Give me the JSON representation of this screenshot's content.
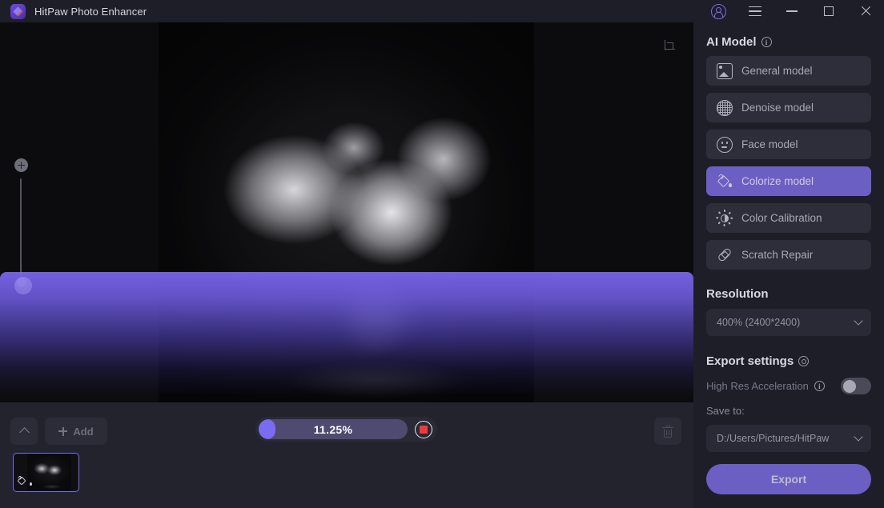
{
  "titlebar": {
    "app_title": "HitPaw Photo Enhancer",
    "logo_icon": "hitpaw-gem-icon",
    "account_icon": "user-account-icon",
    "menu_icon": "hamburger-menu-icon",
    "minimize_icon": "minimize-icon",
    "maximize_icon": "maximize-icon",
    "close_icon": "close-icon"
  },
  "canvas": {
    "crop_icon": "crop-icon",
    "zoom_in_icon": "zoom-in-plus-icon",
    "zoom_slider_handle": "zoom-slider-handle",
    "image_description": "Black and white photo of white roses in a vase"
  },
  "bottombar": {
    "collapse_icon": "chevron-up-icon",
    "add_label": "Add",
    "add_icon": "plus-icon",
    "delete_icon": "trash-icon",
    "thumbnail_badge_icon": "colorize-bucket-icon"
  },
  "progress": {
    "percent_label": "11.25%",
    "percent_value": 11.25,
    "stop_icon": "stop-square-icon"
  },
  "sidebar": {
    "ai_model": {
      "title": "AI Model",
      "info_icon": "info-icon",
      "models": [
        {
          "label": "General model",
          "icon": "picture-icon",
          "selected": false
        },
        {
          "label": "Denoise model",
          "icon": "mesh-icon",
          "selected": false
        },
        {
          "label": "Face model",
          "icon": "face-icon",
          "selected": false
        },
        {
          "label": "Colorize model",
          "icon": "bucket-icon",
          "selected": true
        },
        {
          "label": "Color Calibration",
          "icon": "sun-icon",
          "selected": false
        },
        {
          "label": "Scratch Repair",
          "icon": "bandage-icon",
          "selected": false
        }
      ]
    },
    "resolution": {
      "title": "Resolution",
      "selected": "400% (2400*2400)",
      "chevron_icon": "chevron-down-icon"
    },
    "export_settings": {
      "title": "Export settings",
      "gear_icon": "gear-icon",
      "high_res_label": "High Res Acceleration",
      "high_res_info_icon": "info-icon",
      "high_res_enabled": false,
      "save_to_label": "Save to:",
      "save_to_path": "D:/Users/Pictures/HitPaw",
      "chevron_icon": "chevron-down-icon"
    },
    "export_button_label": "Export"
  },
  "colors": {
    "accent_purple": "#6B5FC4",
    "progress_fill": "#7B6BF0",
    "progress_track": "#4F4A70",
    "stop_red": "#F03A3A",
    "panel_bg": "#1E1E28",
    "canvas_bg": "#0C0C0E",
    "bottom_bg": "#23232E"
  }
}
